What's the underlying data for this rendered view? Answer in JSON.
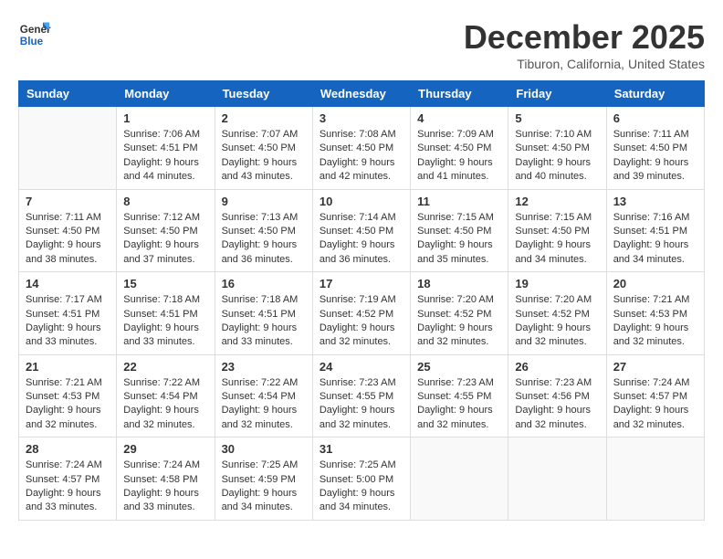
{
  "header": {
    "logo_general": "General",
    "logo_blue": "Blue",
    "month": "December 2025",
    "location": "Tiburon, California, United States"
  },
  "days_of_week": [
    "Sunday",
    "Monday",
    "Tuesday",
    "Wednesday",
    "Thursday",
    "Friday",
    "Saturday"
  ],
  "weeks": [
    [
      {
        "day": "",
        "empty": true
      },
      {
        "day": "1",
        "sunrise": "Sunrise: 7:06 AM",
        "sunset": "Sunset: 4:51 PM",
        "daylight": "Daylight: 9 hours and 44 minutes."
      },
      {
        "day": "2",
        "sunrise": "Sunrise: 7:07 AM",
        "sunset": "Sunset: 4:50 PM",
        "daylight": "Daylight: 9 hours and 43 minutes."
      },
      {
        "day": "3",
        "sunrise": "Sunrise: 7:08 AM",
        "sunset": "Sunset: 4:50 PM",
        "daylight": "Daylight: 9 hours and 42 minutes."
      },
      {
        "day": "4",
        "sunrise": "Sunrise: 7:09 AM",
        "sunset": "Sunset: 4:50 PM",
        "daylight": "Daylight: 9 hours and 41 minutes."
      },
      {
        "day": "5",
        "sunrise": "Sunrise: 7:10 AM",
        "sunset": "Sunset: 4:50 PM",
        "daylight": "Daylight: 9 hours and 40 minutes."
      },
      {
        "day": "6",
        "sunrise": "Sunrise: 7:11 AM",
        "sunset": "Sunset: 4:50 PM",
        "daylight": "Daylight: 9 hours and 39 minutes."
      }
    ],
    [
      {
        "day": "7",
        "sunrise": "Sunrise: 7:11 AM",
        "sunset": "Sunset: 4:50 PM",
        "daylight": "Daylight: 9 hours and 38 minutes."
      },
      {
        "day": "8",
        "sunrise": "Sunrise: 7:12 AM",
        "sunset": "Sunset: 4:50 PM",
        "daylight": "Daylight: 9 hours and 37 minutes."
      },
      {
        "day": "9",
        "sunrise": "Sunrise: 7:13 AM",
        "sunset": "Sunset: 4:50 PM",
        "daylight": "Daylight: 9 hours and 36 minutes."
      },
      {
        "day": "10",
        "sunrise": "Sunrise: 7:14 AM",
        "sunset": "Sunset: 4:50 PM",
        "daylight": "Daylight: 9 hours and 36 minutes."
      },
      {
        "day": "11",
        "sunrise": "Sunrise: 7:15 AM",
        "sunset": "Sunset: 4:50 PM",
        "daylight": "Daylight: 9 hours and 35 minutes."
      },
      {
        "day": "12",
        "sunrise": "Sunrise: 7:15 AM",
        "sunset": "Sunset: 4:50 PM",
        "daylight": "Daylight: 9 hours and 34 minutes."
      },
      {
        "day": "13",
        "sunrise": "Sunrise: 7:16 AM",
        "sunset": "Sunset: 4:51 PM",
        "daylight": "Daylight: 9 hours and 34 minutes."
      }
    ],
    [
      {
        "day": "14",
        "sunrise": "Sunrise: 7:17 AM",
        "sunset": "Sunset: 4:51 PM",
        "daylight": "Daylight: 9 hours and 33 minutes."
      },
      {
        "day": "15",
        "sunrise": "Sunrise: 7:18 AM",
        "sunset": "Sunset: 4:51 PM",
        "daylight": "Daylight: 9 hours and 33 minutes."
      },
      {
        "day": "16",
        "sunrise": "Sunrise: 7:18 AM",
        "sunset": "Sunset: 4:51 PM",
        "daylight": "Daylight: 9 hours and 33 minutes."
      },
      {
        "day": "17",
        "sunrise": "Sunrise: 7:19 AM",
        "sunset": "Sunset: 4:52 PM",
        "daylight": "Daylight: 9 hours and 32 minutes."
      },
      {
        "day": "18",
        "sunrise": "Sunrise: 7:20 AM",
        "sunset": "Sunset: 4:52 PM",
        "daylight": "Daylight: 9 hours and 32 minutes."
      },
      {
        "day": "19",
        "sunrise": "Sunrise: 7:20 AM",
        "sunset": "Sunset: 4:52 PM",
        "daylight": "Daylight: 9 hours and 32 minutes."
      },
      {
        "day": "20",
        "sunrise": "Sunrise: 7:21 AM",
        "sunset": "Sunset: 4:53 PM",
        "daylight": "Daylight: 9 hours and 32 minutes."
      }
    ],
    [
      {
        "day": "21",
        "sunrise": "Sunrise: 7:21 AM",
        "sunset": "Sunset: 4:53 PM",
        "daylight": "Daylight: 9 hours and 32 minutes."
      },
      {
        "day": "22",
        "sunrise": "Sunrise: 7:22 AM",
        "sunset": "Sunset: 4:54 PM",
        "daylight": "Daylight: 9 hours and 32 minutes."
      },
      {
        "day": "23",
        "sunrise": "Sunrise: 7:22 AM",
        "sunset": "Sunset: 4:54 PM",
        "daylight": "Daylight: 9 hours and 32 minutes."
      },
      {
        "day": "24",
        "sunrise": "Sunrise: 7:23 AM",
        "sunset": "Sunset: 4:55 PM",
        "daylight": "Daylight: 9 hours and 32 minutes."
      },
      {
        "day": "25",
        "sunrise": "Sunrise: 7:23 AM",
        "sunset": "Sunset: 4:55 PM",
        "daylight": "Daylight: 9 hours and 32 minutes."
      },
      {
        "day": "26",
        "sunrise": "Sunrise: 7:23 AM",
        "sunset": "Sunset: 4:56 PM",
        "daylight": "Daylight: 9 hours and 32 minutes."
      },
      {
        "day": "27",
        "sunrise": "Sunrise: 7:24 AM",
        "sunset": "Sunset: 4:57 PM",
        "daylight": "Daylight: 9 hours and 32 minutes."
      }
    ],
    [
      {
        "day": "28",
        "sunrise": "Sunrise: 7:24 AM",
        "sunset": "Sunset: 4:57 PM",
        "daylight": "Daylight: 9 hours and 33 minutes."
      },
      {
        "day": "29",
        "sunrise": "Sunrise: 7:24 AM",
        "sunset": "Sunset: 4:58 PM",
        "daylight": "Daylight: 9 hours and 33 minutes."
      },
      {
        "day": "30",
        "sunrise": "Sunrise: 7:25 AM",
        "sunset": "Sunset: 4:59 PM",
        "daylight": "Daylight: 9 hours and 34 minutes."
      },
      {
        "day": "31",
        "sunrise": "Sunrise: 7:25 AM",
        "sunset": "Sunset: 5:00 PM",
        "daylight": "Daylight: 9 hours and 34 minutes."
      },
      {
        "day": "",
        "empty": true
      },
      {
        "day": "",
        "empty": true
      },
      {
        "day": "",
        "empty": true
      }
    ]
  ]
}
